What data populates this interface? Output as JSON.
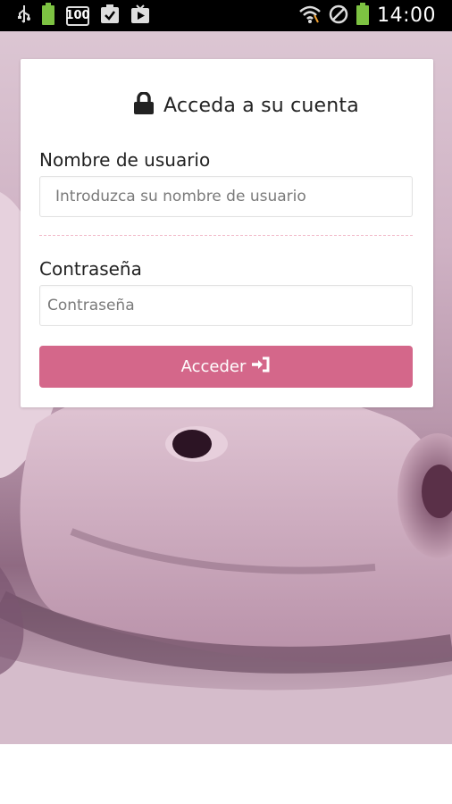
{
  "status_bar": {
    "left_icons": [
      "usb-icon",
      "battery-icon",
      "battery-100-badge-icon",
      "clipboard-check-icon",
      "play-store-icon"
    ],
    "battery_badge_text": "100",
    "right_icons": [
      "wifi-icon",
      "no-signal-icon",
      "battery-full-icon"
    ],
    "time": "14:00"
  },
  "login": {
    "title": "Acceda a su cuenta",
    "title_icon": "lock-icon",
    "username_label": "Nombre de usuario",
    "username_placeholder": "Introduzca su nombre de usuario",
    "password_label": "Contraseña",
    "password_placeholder": "Contraseña",
    "submit_label": "Acceder",
    "submit_icon": "sign-in-icon",
    "accent_color": "#d4678a"
  }
}
